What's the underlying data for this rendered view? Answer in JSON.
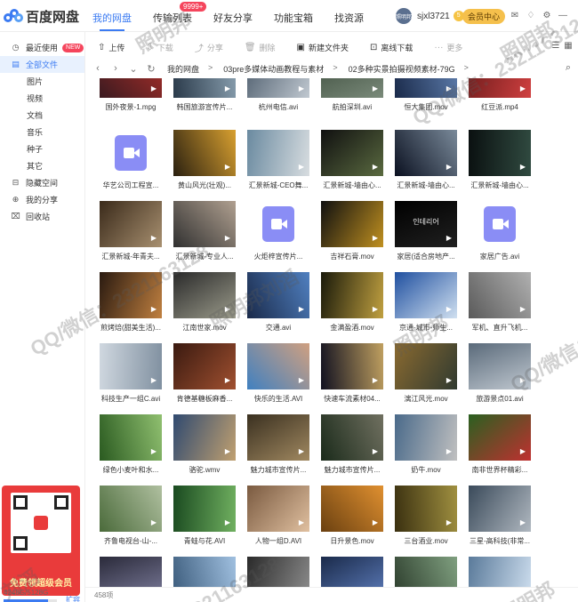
{
  "app": {
    "name": "百度网盘"
  },
  "nav": [
    {
      "label": "我的网盘",
      "active": true
    },
    {
      "label": "传输列表",
      "badge": "9999+"
    },
    {
      "label": "好友分享"
    },
    {
      "label": "功能宝箱"
    },
    {
      "label": "找资源"
    }
  ],
  "user": {
    "avatar_text": "照明邦",
    "name": "sjxl3721",
    "coin": "5",
    "vip_button": "会员中心"
  },
  "sidebar": {
    "items": [
      {
        "label": "最近使用",
        "icon": "clock-icon",
        "badge": "NEW"
      },
      {
        "label": "全部文件",
        "icon": "folder-icon",
        "active": true
      },
      {
        "label": "图片",
        "sub": true
      },
      {
        "label": "视频",
        "sub": true
      },
      {
        "label": "文档",
        "sub": true
      },
      {
        "label": "音乐",
        "sub": true
      },
      {
        "label": "种子",
        "sub": true
      },
      {
        "label": "其它",
        "sub": true
      },
      {
        "label": "隐藏空间",
        "icon": "lock-icon"
      },
      {
        "label": "我的分享",
        "icon": "share-icon"
      },
      {
        "label": "回收站",
        "icon": "trash-icon"
      }
    ],
    "promo_text": "免费领超级会员",
    "storage_text": "4248G/5128G",
    "storage_fraction": 0.83,
    "expand_label": "扩容"
  },
  "toolbar": {
    "upload": "上传",
    "download": "下载",
    "share": "分享",
    "delete": "删除",
    "new_folder": "新建文件夹",
    "offline": "离线下载",
    "more": "更多"
  },
  "breadcrumb": [
    "我的网盘",
    "03pre多媒体动画教程与素材",
    "02多种实景拍摄视频素材-79G"
  ],
  "files": [
    {
      "name": "国外夜景-1.mpg",
      "kind": "thumb",
      "colors": [
        "#3a1a20",
        "#b0302a"
      ]
    },
    {
      "name": "韩国旅游宣传片...",
      "kind": "thumb",
      "colors": [
        "#2a3a4a",
        "#8aa0b0"
      ]
    },
    {
      "name": "杭州电信.avi",
      "kind": "thumb",
      "colors": [
        "#4a5a6a",
        "#c0c8d0"
      ]
    },
    {
      "name": "航拍深圳.avi",
      "kind": "thumb",
      "colors": [
        "#3a4a3a",
        "#7a8a7a"
      ]
    },
    {
      "name": "恒大集团.mov",
      "kind": "thumb",
      "colors": [
        "#1a2a4a",
        "#6080b0"
      ]
    },
    {
      "name": "红豆派.mp4",
      "kind": "thumb",
      "colors": [
        "#6a1a1a",
        "#d04040"
      ]
    },
    {
      "name": "华艺公司工程宣...",
      "kind": "video-icon"
    },
    {
      "name": "黄山风光(壮观)...",
      "kind": "thumb",
      "colors": [
        "#2a2010",
        "#d8a030"
      ]
    },
    {
      "name": "汇景新城-CEO舞...",
      "kind": "thumb",
      "colors": [
        "#6a8aa0",
        "#d8dde0"
      ]
    },
    {
      "name": "汇景新城-墙由心...",
      "kind": "thumb",
      "colors": [
        "#101010",
        "#5a6a40"
      ]
    },
    {
      "name": "汇景新城-墙由心...",
      "kind": "thumb",
      "colors": [
        "#0a1020",
        "#7a8a9a"
      ]
    },
    {
      "name": "汇景新城-墙由心...",
      "kind": "thumb",
      "colors": [
        "#0a1010",
        "#304a40"
      ]
    },
    {
      "name": "汇景新城-年青夫...",
      "kind": "thumb",
      "colors": [
        "#3a2a1a",
        "#a89070"
      ]
    },
    {
      "name": "汇景新城-专业人...",
      "kind": "thumb",
      "colors": [
        "#303030",
        "#b0a090"
      ]
    },
    {
      "name": "火炬梓宣传片...",
      "kind": "video-icon"
    },
    {
      "name": "吉祥石膏.mov",
      "kind": "thumb",
      "colors": [
        "#101010",
        "#c09020"
      ]
    },
    {
      "name": "家居(适合房地产...",
      "kind": "thumb",
      "colors": [
        "#000000",
        "#202020"
      ],
      "caption": "인테리어"
    },
    {
      "name": "家居广告.avi",
      "kind": "video-icon"
    },
    {
      "name": "煎烤焙(甜美生活)...",
      "kind": "thumb",
      "colors": [
        "#2a1a10",
        "#c08040"
      ]
    },
    {
      "name": "江南世家.mov",
      "kind": "thumb",
      "colors": [
        "#2a2a2a",
        "#9a9a8a"
      ]
    },
    {
      "name": "交通.avi",
      "kind": "thumb",
      "colors": [
        "#1a2a4a",
        "#5080c0"
      ]
    },
    {
      "name": "金满盈酒.mov",
      "kind": "thumb",
      "colors": [
        "#1a1a0a",
        "#c0a040"
      ]
    },
    {
      "name": "京通-城市-师生...",
      "kind": "thumb",
      "colors": [
        "#2050a0",
        "#d0e0f0"
      ]
    },
    {
      "name": "军机、直升飞机...",
      "kind": "thumb",
      "colors": [
        "#5a5a5a",
        "#b0b0b0"
      ]
    },
    {
      "name": "科技生产一组C.avi",
      "kind": "thumb",
      "colors": [
        "#d0d8e0",
        "#8090a0"
      ]
    },
    {
      "name": "肯德基糖板麻香...",
      "kind": "thumb",
      "colors": [
        "#3a1a10",
        "#a05030"
      ]
    },
    {
      "name": "快乐的生活.AVI",
      "kind": "thumb",
      "colors": [
        "#4080c0",
        "#d0a080"
      ]
    },
    {
      "name": "快速车流素材04...",
      "kind": "thumb",
      "colors": [
        "#101020",
        "#c0a060"
      ]
    },
    {
      "name": "漓江风光.mov",
      "kind": "thumb",
      "colors": [
        "#8a6a30",
        "#303a30"
      ]
    },
    {
      "name": "旅游景点01.avi",
      "kind": "thumb",
      "colors": [
        "#5a6a7a",
        "#c0c8d0"
      ]
    },
    {
      "name": "绿色小麦叶和水...",
      "kind": "thumb",
      "colors": [
        "#2a5a20",
        "#90c070"
      ]
    },
    {
      "name": "骆驼.wmv",
      "kind": "thumb",
      "colors": [
        "#304a70",
        "#c0a070"
      ]
    },
    {
      "name": "魅力城市宣传片...",
      "kind": "thumb",
      "colors": [
        "#3a3020",
        "#a08860"
      ]
    },
    {
      "name": "魅力城市宣传片...",
      "kind": "thumb",
      "colors": [
        "#1a2a1a",
        "#707060"
      ]
    },
    {
      "name": "奶牛.mov",
      "kind": "thumb",
      "colors": [
        "#4a6a8a",
        "#c0c0c0"
      ]
    },
    {
      "name": "南非世界杯精彩...",
      "kind": "thumb",
      "colors": [
        "#2a6020",
        "#c03030"
      ]
    },
    {
      "name": "齐鲁电视台-山-...",
      "kind": "thumb",
      "colors": [
        "#4a6a3a",
        "#b0c0a0"
      ]
    },
    {
      "name": "青蛙与花.AVI",
      "kind": "thumb",
      "colors": [
        "#1a4a20",
        "#70b060"
      ]
    },
    {
      "name": "人物一组D.AVI",
      "kind": "thumb",
      "colors": [
        "#7a5a40",
        "#e0c0a0"
      ]
    },
    {
      "name": "日升景色.mov",
      "kind": "thumb",
      "colors": [
        "#6a4010",
        "#e09030"
      ]
    },
    {
      "name": "三台酒业.mov",
      "kind": "thumb",
      "colors": [
        "#3a3010",
        "#a09040"
      ]
    },
    {
      "name": "三星-高科技(非常...",
      "kind": "thumb",
      "colors": [
        "#3a4a5a",
        "#b0b8c0"
      ]
    },
    {
      "name": "",
      "kind": "thumb",
      "colors": [
        "#2a2a3a",
        "#8080a0"
      ]
    },
    {
      "name": "",
      "kind": "thumb",
      "colors": [
        "#3a5a7a",
        "#a0c0e0"
      ]
    },
    {
      "name": "",
      "kind": "thumb",
      "colors": [
        "#2a2a2a",
        "#909090"
      ]
    },
    {
      "name": "",
      "kind": "thumb",
      "colors": [
        "#1a2a4a",
        "#6080c0"
      ]
    },
    {
      "name": "",
      "kind": "thumb",
      "colors": [
        "#2a3a2a",
        "#80a080"
      ]
    },
    {
      "name": "",
      "kind": "thumb",
      "colors": [
        "#5a7a9a",
        "#d0e0f0"
      ]
    }
  ],
  "status": {
    "count": "458项"
  },
  "watermarks": [
    "照明邦",
    "照明邦",
    "QQ/微信：2321163128",
    "刘滔",
    "照明邦刘滔",
    "QQ/微信：2321163128",
    "照明邦",
    "QQ/微信：2321163128",
    "2321163128",
    "照明邦"
  ]
}
